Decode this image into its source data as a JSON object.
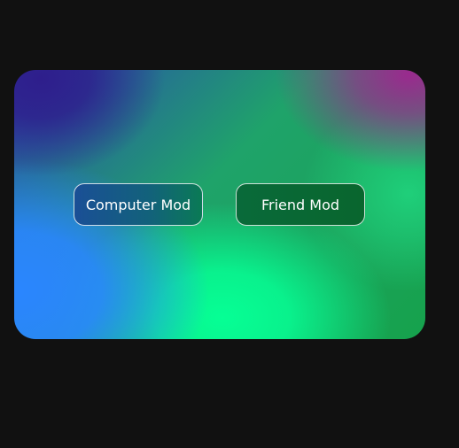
{
  "menu": {
    "computer_mode_label": "Computer Mod",
    "friend_mode_label": "Friend Mod"
  }
}
